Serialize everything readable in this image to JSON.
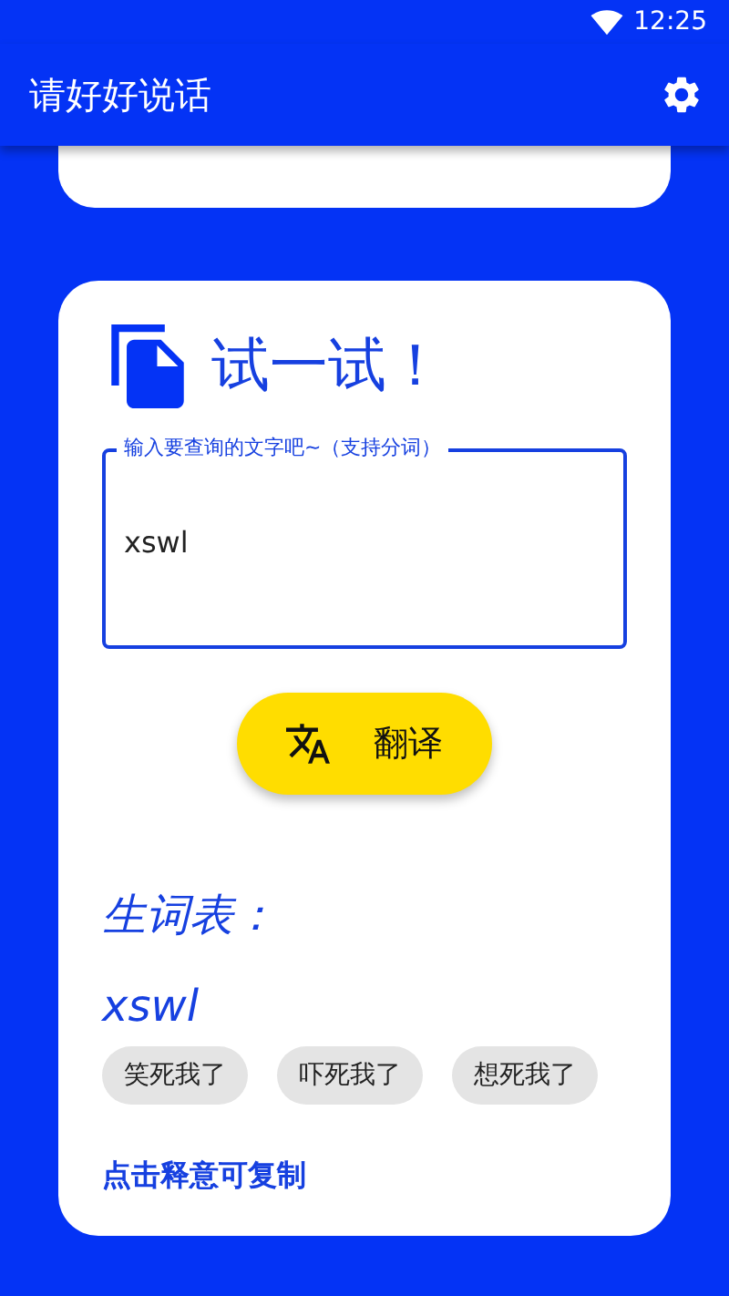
{
  "status_bar": {
    "time": "12:25"
  },
  "app_bar": {
    "title": "请好好说话"
  },
  "card": {
    "title": "试一试！",
    "input": {
      "label": "输入要查询的文字吧~（支持分词）",
      "value": "xswl"
    },
    "button": {
      "label": "翻译"
    },
    "vocabulary": {
      "heading": "生词表：",
      "entries": [
        {
          "word": "xswl",
          "meanings": [
            "笑死我了",
            "吓死我了",
            "想死我了"
          ]
        }
      ]
    },
    "hint": "点击释意可复制"
  }
}
